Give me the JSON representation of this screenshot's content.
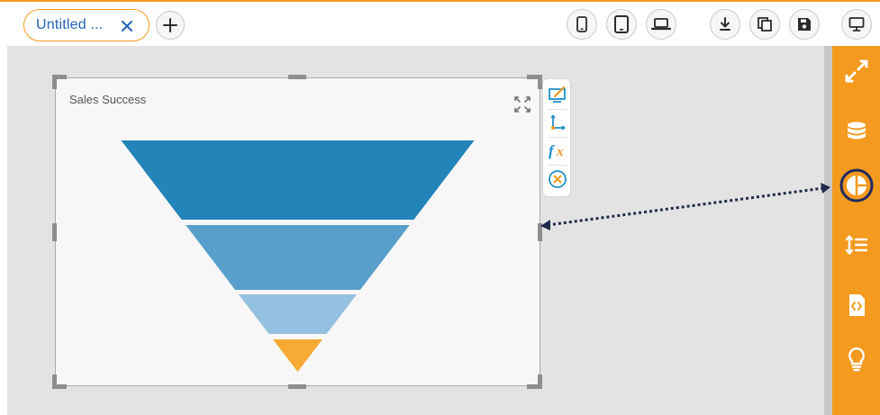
{
  "tab": {
    "label": "Untitled ...",
    "close_icon": "close-icon"
  },
  "toolbar": {
    "add_icon": "plus-icon",
    "device_icons": [
      "mobile-icon",
      "tablet-icon",
      "laptop-icon"
    ],
    "action_icons": [
      "download-icon",
      "copy-icon",
      "save-icon",
      "desktop-preview-icon"
    ]
  },
  "widget": {
    "title": "Sales Success",
    "expand_icon": "expand-icon",
    "tools": [
      "chart-properties-icon",
      "axis-icon",
      "formula-icon",
      "remove-icon"
    ]
  },
  "chart_data": {
    "type": "funnel",
    "title": "Sales Success",
    "stages": [
      {
        "color": "#2384b9"
      },
      {
        "color": "#58a0cb"
      },
      {
        "color": "#95c0df"
      },
      {
        "color": "#f7ab34"
      }
    ]
  },
  "sidebar": {
    "items": [
      {
        "icon": "fullscreen-icon",
        "selected": false
      },
      {
        "icon": "database-icon",
        "selected": false
      },
      {
        "icon": "pie-chart-icon",
        "selected": true
      },
      {
        "icon": "sort-lines-icon",
        "selected": false
      },
      {
        "icon": "code-icon",
        "selected": false
      },
      {
        "icon": "lightbulb-icon",
        "selected": false
      }
    ]
  },
  "colors": {
    "accent": "#f39a1f",
    "tab_text": "#1f63b5",
    "canvas_bg": "#e3e3e3",
    "selected_ring": "#1f2a5e"
  }
}
